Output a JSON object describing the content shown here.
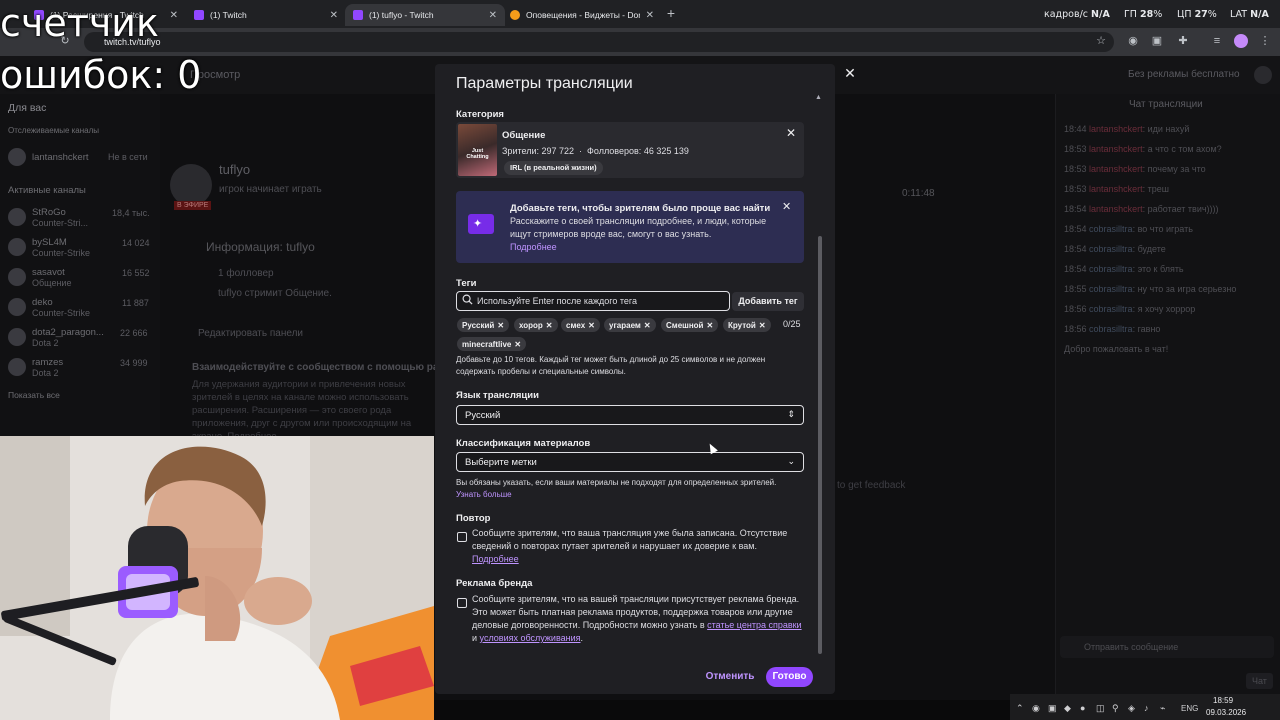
{
  "browser": {
    "tabs": [
      {
        "label": "(1) Расширения - Twitch",
        "icon": "twitch-icon"
      },
      {
        "label": "(1) Twitch",
        "icon": "twitch-icon"
      },
      {
        "label": "(1) tuflyo - Twitch",
        "icon": "twitch-icon"
      },
      {
        "label": "Оповещения - Виджеты - Don",
        "icon": "donationalerts-icon"
      }
    ],
    "url": "twitch.tv/tuflyo",
    "stats": {
      "fps_label": "кадров/с",
      "fps_value": "N/A",
      "gpu_label": "ГП",
      "gpu_value": "28",
      "gpu_unit": "%",
      "cpu_label": "ЦП",
      "cpu_value": "27",
      "cpu_unit": "%",
      "lat_label": "LAT",
      "lat_value": "N/A"
    }
  },
  "overlay": {
    "line1": "счетчик",
    "line2": "ошибок: 0"
  },
  "background": {
    "topnav_item": "Просмотр",
    "no_ads": "Без рекламы бесплатно",
    "for_you": "Для вас",
    "followed": "Отслеживаемые каналы",
    "active": "Активные каналы",
    "channels": [
      {
        "name": "lantanshckert",
        "game": "",
        "viewers": "Не в сети"
      },
      {
        "name": "StRoGo",
        "game": "Counter-Stri...",
        "viewers": "18,4 тыс."
      },
      {
        "name": "bySL4M",
        "game": "Counter-Strike",
        "viewers": "14 024"
      },
      {
        "name": "sasavot",
        "game": "Общение",
        "viewers": "16 552"
      },
      {
        "name": "deko",
        "game": "Counter-Strike",
        "viewers": "11 887"
      },
      {
        "name": "dota2_paragon...",
        "game": "Dota 2",
        "viewers": "22 666"
      },
      {
        "name": "ramzes",
        "game": "Dota 2",
        "viewers": "34 999"
      }
    ],
    "show_all": "Показать все",
    "streamer": "tuflyo",
    "stream_title": "игрок начинает играть",
    "live": "В ЭФИРЕ",
    "info_heading": "Информация: tuflyo",
    "followers": "1 фолловер",
    "streams": "tuflyo стримит Общение.",
    "edit_panels": "Редактировать панели",
    "engage": "Взаимодействуйте с сообществом с помощью расширений",
    "engage_body": "Для удержания аудитории и привлечения новых зрителей в целях на канале можно использовать расширения. Расширения — это своего рода приложения, друг с другом или происходящим на экране. Подробнее",
    "feedback": "to get feedback",
    "uptime": "0:11:48",
    "chat_title": "Чат трансляции",
    "chat": [
      {
        "time": "18:44",
        "user": "lantanshckert",
        "msg": "иди нахуй"
      },
      {
        "time": "18:53",
        "user": "lantanshckert",
        "msg": "а что с том ахом?"
      },
      {
        "time": "18:53",
        "user": "lantanshckert",
        "msg": "почему за что"
      },
      {
        "time": "18:53",
        "user": "lantanshckert",
        "msg": "треш"
      },
      {
        "time": "18:54",
        "user": "lantanshckert",
        "msg": "работает твич))))"
      },
      {
        "time": "18:54",
        "user": "cobrasilltra",
        "msg": "во что играть"
      },
      {
        "time": "18:54",
        "user": "cobrasilltra",
        "msg": "будете"
      },
      {
        "time": "18:54",
        "user": "cobrasilltra",
        "msg": "это к блять"
      },
      {
        "time": "18:55",
        "user": "cobrasilltra",
        "msg": "ну что за игра серьезно"
      },
      {
        "time": "18:56",
        "user": "cobrasilltra",
        "msg": "я хочу хоррор"
      },
      {
        "time": "18:56",
        "user": "cobrasilltra",
        "msg": "гавно"
      }
    ],
    "chat_welcome": "Добро пожаловать в чат!",
    "chat_placeholder": "Отправить сообщение",
    "chat_btn": "Чат"
  },
  "modal": {
    "title": "Параметры трансляции",
    "category_label": "Категория",
    "category": {
      "name": "Общение",
      "viewers_label": "Зрители:",
      "viewers": "297 722",
      "followers_label": "Фолловеров:",
      "followers": "46 325 139",
      "tag": "IRL (в реальной жизни)",
      "art_text": "Just Chatting"
    },
    "promo": {
      "title": "Добавьте теги, чтобы зрителям было проще вас найти",
      "body": "Расскажите о своей трансляции подробнее, и люди, которые ищут стримеров вроде вас, смогут о вас узнать.",
      "link": "Подробнее"
    },
    "tags_label": "Теги",
    "tags_placeholder": "Используйте Enter после каждого тега",
    "add_tag": "Добавить тег",
    "tags": [
      "Русский",
      "хорор",
      "смех",
      "угараем",
      "Смешной",
      "Крутой",
      "minecraftlive"
    ],
    "tag_count": "0/25",
    "tags_hint": "Добавьте до 10 тегов. Каждый тег может быть длиной до 25 символов и не должен содержать пробелы и специальные символы.",
    "language_label": "Язык трансляции",
    "language_value": "Русский",
    "classification_label": "Классификация материалов",
    "classification_value": "Выберите метки",
    "classification_hint": "Вы обязаны указать, если ваши материалы не подходят для определенных зрителей.",
    "classification_link": "Узнать больше",
    "rerun_label": "Повтор",
    "rerun_text": "Сообщите зрителям, что ваша трансляция уже была записана. Отсутствие сведений о повторах путает зрителей и нарушает их доверие к вам.",
    "rerun_link": "Подробнее",
    "brand_label": "Реклама бренда",
    "brand_text": "Сообщите зрителям, что на вашей трансляции присутствует реклама бренда. Это может быть платная реклама продуктов, поддержка товаров или другие деловые договоренности. Подробности можно узнать в",
    "brand_link1": "статье центра справки",
    "brand_and": "и",
    "brand_link2": "условиях обслуживания",
    "cancel": "Отменить",
    "done": "Готово"
  },
  "taskbar": {
    "lang": "ENG",
    "time": "18:59",
    "date": "09.03.2026"
  },
  "colors": {
    "accent": "#9147ff",
    "link": "#bf94ff",
    "modal_bg": "#1f1f23",
    "promo_bg": "#2d2d52"
  }
}
